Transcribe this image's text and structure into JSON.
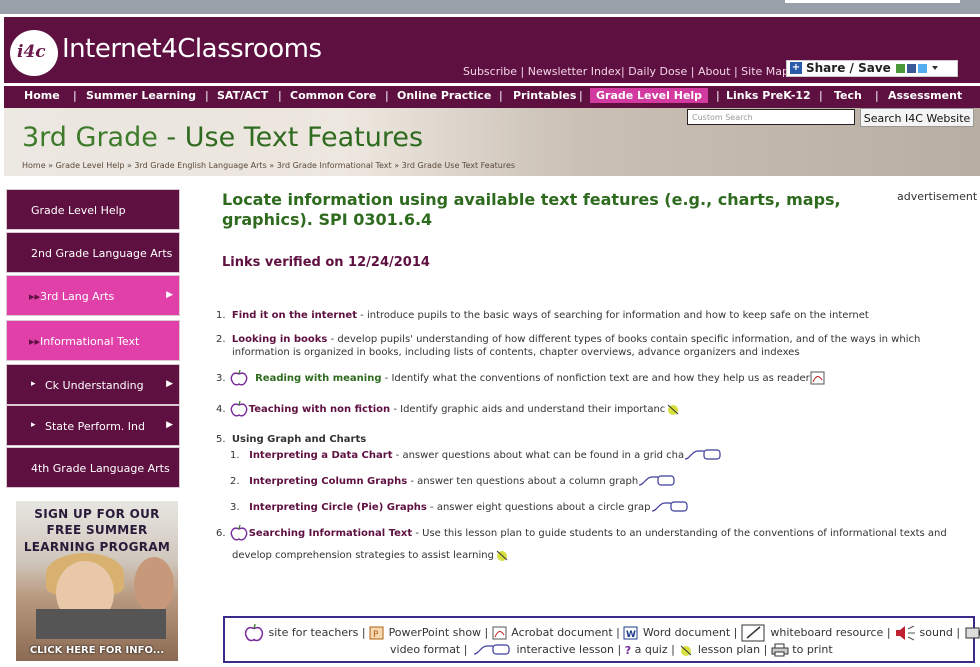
{
  "brand": {
    "logo_mark": "i4c",
    "name": "Internet4Classrooms"
  },
  "top_links": [
    "Subscribe",
    "Newsletter Index",
    "Daily Dose",
    "About",
    "Site Map"
  ],
  "share_label": "Share / Save",
  "nav": [
    "Home",
    "Summer Learning",
    "SAT/ACT",
    "Common Core",
    "Online Practice",
    "Printables",
    "Grade Level Help",
    "Links PreK-12",
    "Tech",
    "Assessment"
  ],
  "nav_active": "Grade Level Help",
  "search": {
    "placeholder": "Custom Search",
    "button": "Search I4C Website"
  },
  "banner": {
    "grade": "3rd Grade",
    "topic": " - Use Text Features"
  },
  "breadcrumb": "Home » Grade Level Help » 3rd Grade English Language Arts » 3rd Grade Informational Text » 3rd Grade Use Text Features",
  "sidebar": [
    {
      "label": "Grade Level Help"
    },
    {
      "label": "2nd Grade Language Arts"
    },
    {
      "label": "3rd Lang Arts"
    },
    {
      "label": "Informational Text"
    },
    {
      "label": "Ck Understanding"
    },
    {
      "label": "State Perform. Ind"
    },
    {
      "label": "4th Grade Language Arts"
    }
  ],
  "promo": {
    "line1": "SIGN UP FOR OUR",
    "line2": "FREE SUMMER",
    "line3": "LEARNING PROGRAM",
    "cta": "CLICK HERE FOR INFO..."
  },
  "main": {
    "heading": "Locate information using available text features (e.g., charts, maps, graphics). SPI 0301.6.4",
    "advertisement": "advertisement",
    "verified": "Links verified on 12/24/2014",
    "items": [
      {
        "num": "1.",
        "link": "Find it on the internet",
        "desc": " - introduce pupils to the basic ways of searching for information and how to keep safe on the internet"
      },
      {
        "num": "2.",
        "link": "Looking in books",
        "desc": " - develop pupils' understanding of how different types of books contain specific information, and of the ways in which",
        "desc2": "information is organized in books, including lists of contents, chapter overviews, advance organizers and indexes"
      },
      {
        "num": "3.",
        "link": "Reading with meaning",
        "desc": " - Identify what the conventions of nonfiction text are and how they help us as reader"
      },
      {
        "num": "4.",
        "link": "Teaching with non fiction",
        "desc": " - Identify graphic aids and understand their importanc"
      },
      {
        "num": "5.",
        "link": "Using Graph and Charts",
        "desc": ""
      },
      {
        "num": "1.",
        "link": "Interpreting a Data Chart",
        "desc": " - answer questions about what can be found in a grid cha"
      },
      {
        "num": "2.",
        "link": "Interpreting Column Graphs",
        "desc": " - answer ten questions about a column graph"
      },
      {
        "num": "3.",
        "link": "Interpreting Circle (Pie) Graphs",
        "desc": " - answer eight questions about a circle grap"
      },
      {
        "num": "6.",
        "link": "Searching Informational Text",
        "desc": " - Use this lesson plan to guide students to an understanding of the conventions of informational texts and",
        "desc2": "develop comprehension strategies to assist learning"
      }
    ]
  },
  "legend": {
    "site_for_teachers": "site for teachers |",
    "powerpoint": "PowerPoint show |",
    "acrobat": "Acrobat document |",
    "word": "Word document |",
    "whiteboard": "whiteboard resource |",
    "sound": "sound |",
    "video": "video format |",
    "interactive": "interactive lesson |",
    "quiz": "a quiz |",
    "lesson_plan": "lesson plan |",
    "print": "to print"
  },
  "colors": {
    "brand": "#5e1040",
    "accent_pink": "#e040a8",
    "heading_green": "#2f6b1f"
  }
}
